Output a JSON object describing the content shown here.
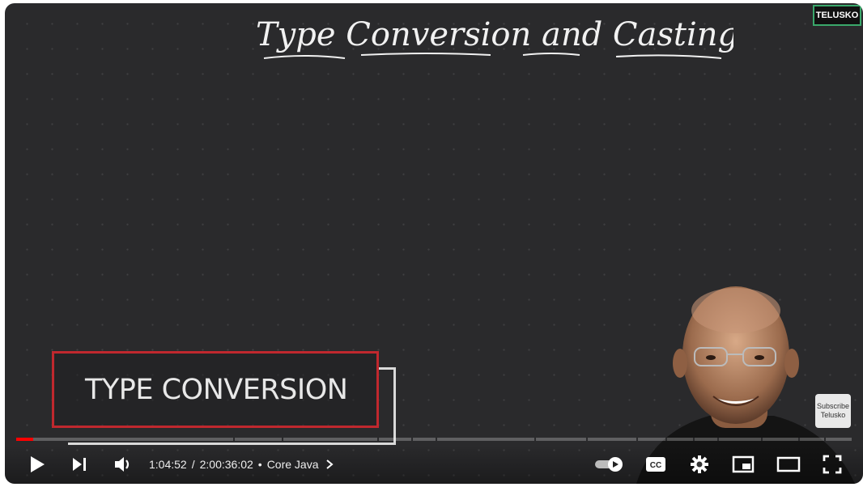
{
  "video": {
    "board_title": "Type Conversion and Casting",
    "channel_logo": "TELUSKO",
    "lower_third": "TYPE CONVERSION",
    "subscribe": {
      "line1": "Subscribe",
      "line2": "Telusko"
    }
  },
  "player": {
    "progress_played_fraction": 0.02,
    "current_time": "1:04:52",
    "duration": "2:00:36:02",
    "time_separator": "/",
    "chapter_bullet": "•",
    "chapter_title": "Core Java",
    "colors": {
      "played": "#ff0000",
      "lower_third_red": "#c0282e",
      "logo_border": "#3aa86b"
    },
    "icons": [
      "play-icon",
      "next-icon",
      "volume-icon",
      "chevron-right-icon",
      "autoplay-toggle-icon",
      "captions-icon",
      "settings-icon",
      "miniplayer-icon",
      "theater-mode-icon",
      "fullscreen-icon"
    ]
  }
}
